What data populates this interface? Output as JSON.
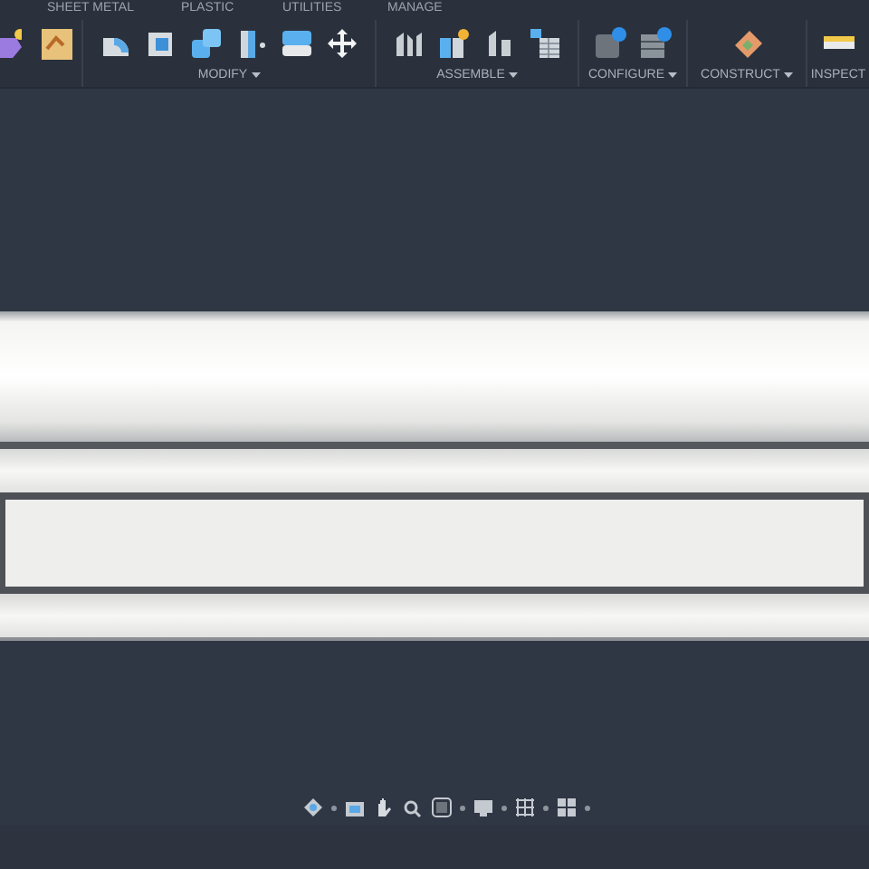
{
  "tabs": [
    {
      "label": "SHEET METAL",
      "selected": false
    },
    {
      "label": "PLASTIC",
      "selected": false
    },
    {
      "label": "UTILITIES",
      "selected": false
    },
    {
      "label": "MANAGE",
      "selected": false
    }
  ],
  "groups": [
    {
      "label": "MODIFY",
      "dropdown": true
    },
    {
      "label": "ASSEMBLE",
      "dropdown": true
    },
    {
      "label": "CONFIGURE",
      "dropdown": true
    },
    {
      "label": "CONSTRUCT",
      "dropdown": true
    },
    {
      "label": "INSPECT",
      "dropdown": false
    }
  ]
}
